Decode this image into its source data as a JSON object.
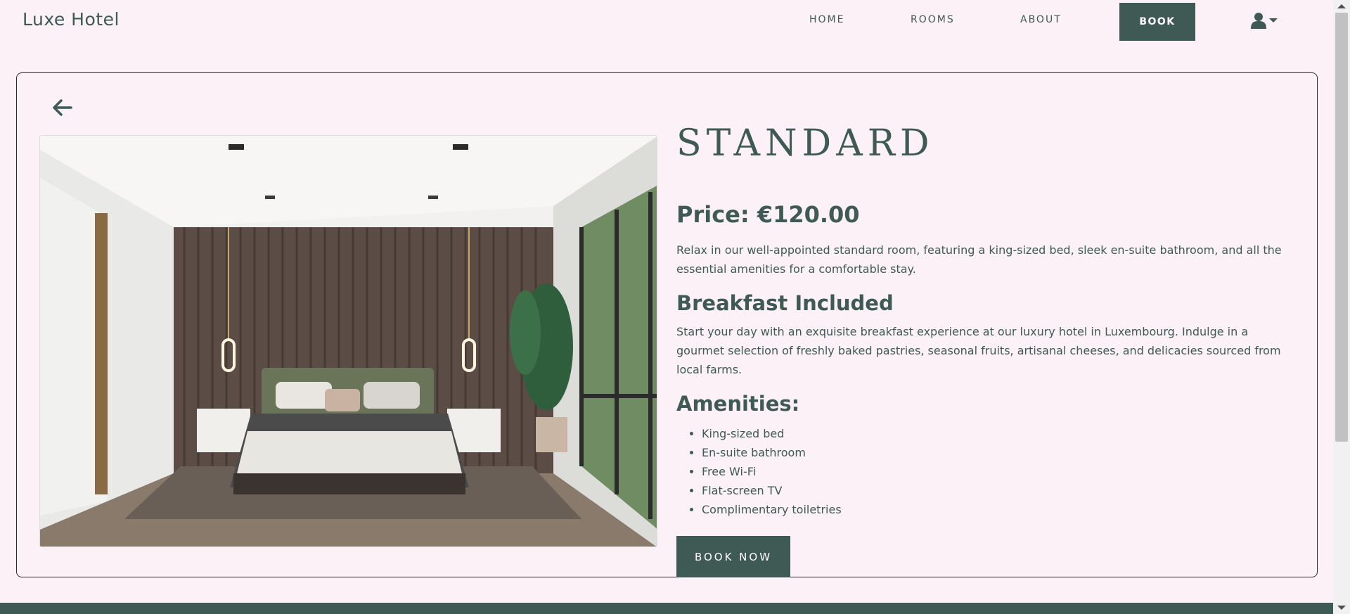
{
  "nav": {
    "brand": "Luxe Hotel",
    "links": [
      "HOME",
      "ROOMS",
      "ABOUT"
    ],
    "book_label": "BOOK",
    "accent_color": "#3f5954"
  },
  "room": {
    "title": "STANDARD",
    "price": "Price: €120.00",
    "description": "Relax in our well-appointed standard room, featuring a king-sized bed, sleek en-suite bathroom, and all the essential amenities for a comfortable stay.",
    "breakfast_heading": "Breakfast Included",
    "breakfast_text": "Start your day with an exquisite breakfast experience at our luxury hotel in Luxembourg. Indulge in a gourmet selection of freshly baked pastries, seasonal fruits, artisanal cheeses, and delicacies sourced from local farms.",
    "amenities_heading": "Amenities:",
    "amenities": [
      "King-sized bed",
      "En-suite bathroom",
      "Free Wi-Fi",
      "Flat-screen TV",
      "Complimentary toiletries"
    ],
    "book_now_label": "BOOK NOW"
  },
  "icons": {
    "back": "arrow-left-icon",
    "user": "user-icon",
    "caret": "caret-down-icon",
    "image": "bedroom-photo"
  }
}
